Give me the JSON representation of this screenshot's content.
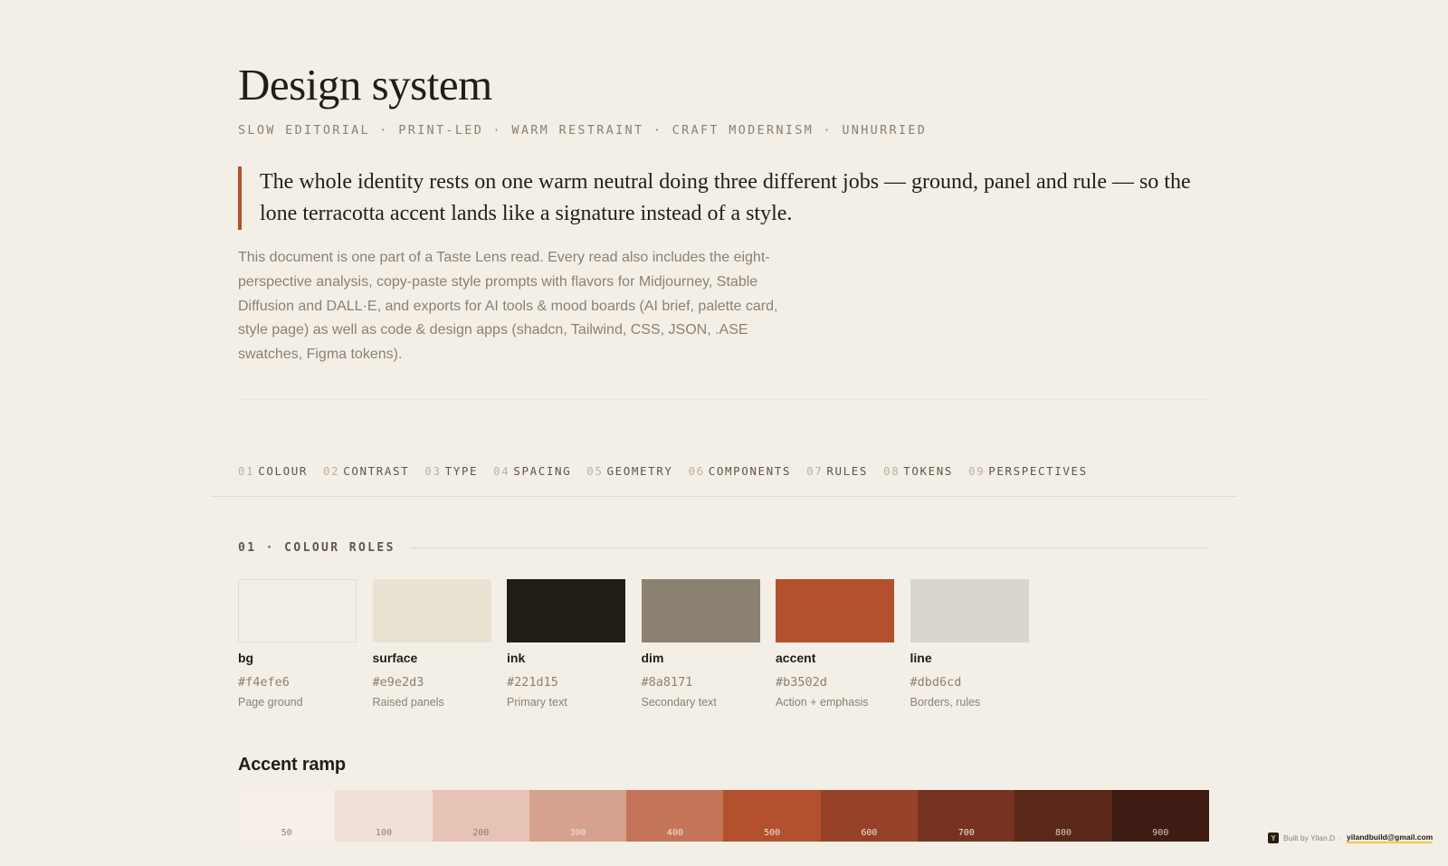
{
  "header": {
    "title": "Design system",
    "tagline": "SLOW EDITORIAL · PRINT-LED · WARM RESTRAINT · CRAFT MODERNISM · UNHURRIED"
  },
  "quote": "The whole identity rests on one warm neutral doing three different jobs — ground, panel and rule — so the lone terracotta accent lands like a signature instead of a style.",
  "intro": "This document is one part of a Taste Lens read. Every read also includes the eight-perspective analysis, copy-paste style prompts with flavors for Midjourney, Stable Diffusion and DALL·E, and exports for AI tools & mood boards (AI brief, palette card, style page) as well as code & design apps (shadcn, Tailwind, CSS, JSON, .ASE swatches, Figma tokens).",
  "nav": [
    {
      "num": "01",
      "label": "COLOUR"
    },
    {
      "num": "02",
      "label": "CONTRAST"
    },
    {
      "num": "03",
      "label": "TYPE"
    },
    {
      "num": "04",
      "label": "SPACING"
    },
    {
      "num": "05",
      "label": "GEOMETRY"
    },
    {
      "num": "06",
      "label": "COMPONENTS"
    },
    {
      "num": "07",
      "label": "RULES"
    },
    {
      "num": "08",
      "label": "TOKENS"
    },
    {
      "num": "09",
      "label": "PERSPECTIVES"
    }
  ],
  "colour_section": {
    "label": "01 · COLOUR ROLES",
    "swatches": [
      {
        "name": "bg",
        "hex": "#f4efe6",
        "role": "Page ground"
      },
      {
        "name": "surface",
        "hex": "#e9e2d3",
        "role": "Raised panels"
      },
      {
        "name": "ink",
        "hex": "#221d15",
        "role": "Primary text"
      },
      {
        "name": "dim",
        "hex": "#8a8171",
        "role": "Secondary text"
      },
      {
        "name": "accent",
        "hex": "#b3502d",
        "role": "Action + emphasis"
      },
      {
        "name": "line",
        "hex": "#dbd6cd",
        "role": "Borders, rules"
      }
    ]
  },
  "accent_ramp": {
    "title": "Accent ramp",
    "steps": [
      {
        "label": "50",
        "color": "#f7efe9",
        "text": "#8a8171"
      },
      {
        "label": "100",
        "color": "#f1e0d8",
        "text": "#8a8171"
      },
      {
        "label": "200",
        "color": "#e6c3b5",
        "text": "#8a8171"
      },
      {
        "label": "300",
        "color": "#d6a18f",
        "text": "#efe3da"
      },
      {
        "label": "400",
        "color": "#c47459",
        "text": "#efe3da"
      },
      {
        "label": "500",
        "color": "#b3502d",
        "text": "#efe3da"
      },
      {
        "label": "600",
        "color": "#964228",
        "text": "#efe3da"
      },
      {
        "label": "700",
        "color": "#773321",
        "text": "#efe3da"
      },
      {
        "label": "800",
        "color": "#5a2819",
        "text": "#d9c8bd"
      },
      {
        "label": "900",
        "color": "#3f1c13",
        "text": "#d9c8bd"
      }
    ]
  },
  "credit": {
    "icon": "Y",
    "text": "Built by Yilan.D",
    "sep": "·",
    "email": "yilandbuild@gmail.com"
  }
}
